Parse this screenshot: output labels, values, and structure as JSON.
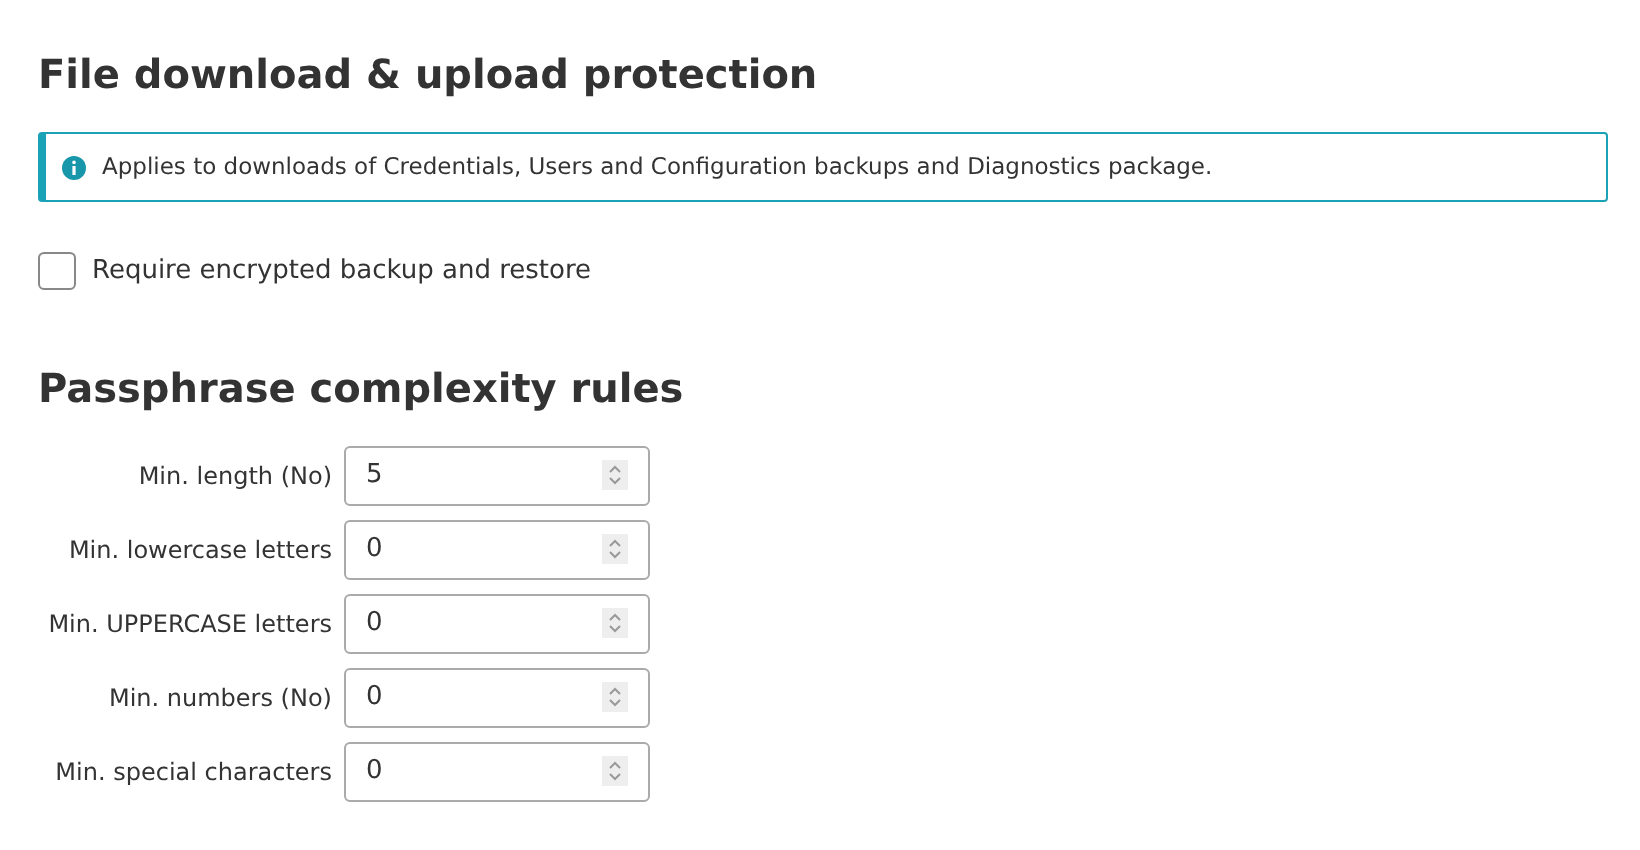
{
  "section_title": "File download & upload protection",
  "info": {
    "text": "Applies to downloads of Credentials, Users and Configuration backups and Diagnostics package."
  },
  "encrypt_option": {
    "label": "Require encrypted backup and restore",
    "checked": false
  },
  "rules_title": "Passphrase complexity rules",
  "rules": [
    {
      "label": "Min. length (No)",
      "value": "5"
    },
    {
      "label": "Min. lowercase letters",
      "value": "0"
    },
    {
      "label": "Min. UPPERCASE letters",
      "value": "0"
    },
    {
      "label": "Min. numbers (No)",
      "value": "0"
    },
    {
      "label": "Min. special characters",
      "value": "0"
    }
  ]
}
